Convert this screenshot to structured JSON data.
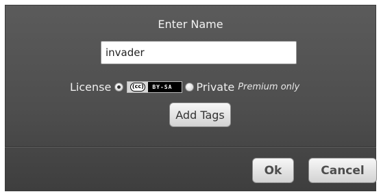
{
  "dialog": {
    "title": "Enter Name",
    "name_field": {
      "value": "invader"
    },
    "license": {
      "label": "License",
      "cc_symbol": "(cc)",
      "cc_type": "BY-SA",
      "cc_selected": true,
      "private_label": "Private",
      "premium_note": "Premium only"
    },
    "add_tags_label": "Add Tags",
    "ok_label": "Ok",
    "cancel_label": "Cancel"
  },
  "colors": {
    "dialog_background": "#4e4e4e",
    "button_background": "#e6e6e6",
    "button_text": "#4d4d4d"
  }
}
